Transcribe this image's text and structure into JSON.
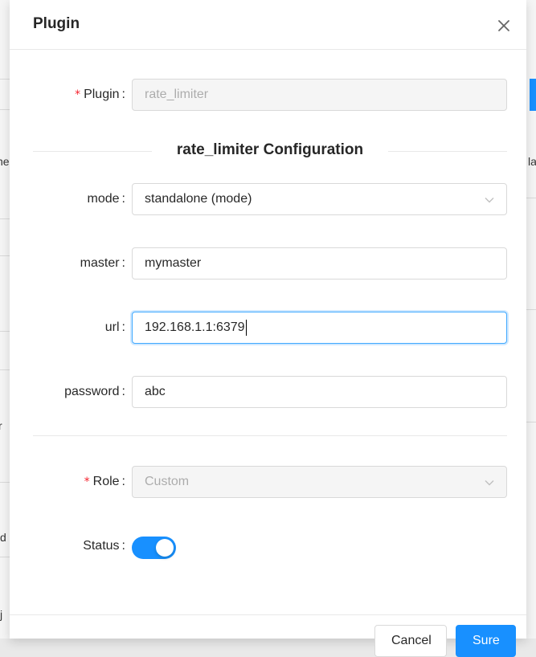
{
  "modal": {
    "title": "Plugin",
    "close_icon": "close-icon"
  },
  "form": {
    "plugin": {
      "label": "Plugin",
      "required": "*",
      "value": "rate_limiter",
      "disabled": true
    },
    "section_title": "rate_limiter Configuration",
    "mode": {
      "label": "mode",
      "value": "standalone (mode)",
      "icon": "chevron-down-icon"
    },
    "master": {
      "label": "master",
      "value": "mymaster"
    },
    "url": {
      "label": "url",
      "value": "192.168.1.1:6379",
      "focused": true
    },
    "password": {
      "label": "password",
      "value": "abc"
    },
    "role": {
      "label": "Role",
      "required": "*",
      "value": "Custom",
      "disabled": true,
      "icon": "chevron-down-icon"
    },
    "status": {
      "label": "Status",
      "enabled": true
    }
  },
  "footer": {
    "cancel_label": "Cancel",
    "ok_label": "Sure"
  },
  "background": {
    "fragments": [
      "ne",
      "r",
      "d",
      "j",
      "la"
    ]
  },
  "colors": {
    "primary": "#1890ff",
    "required": "#f5222d",
    "disabled_bg": "#f5f5f5"
  }
}
